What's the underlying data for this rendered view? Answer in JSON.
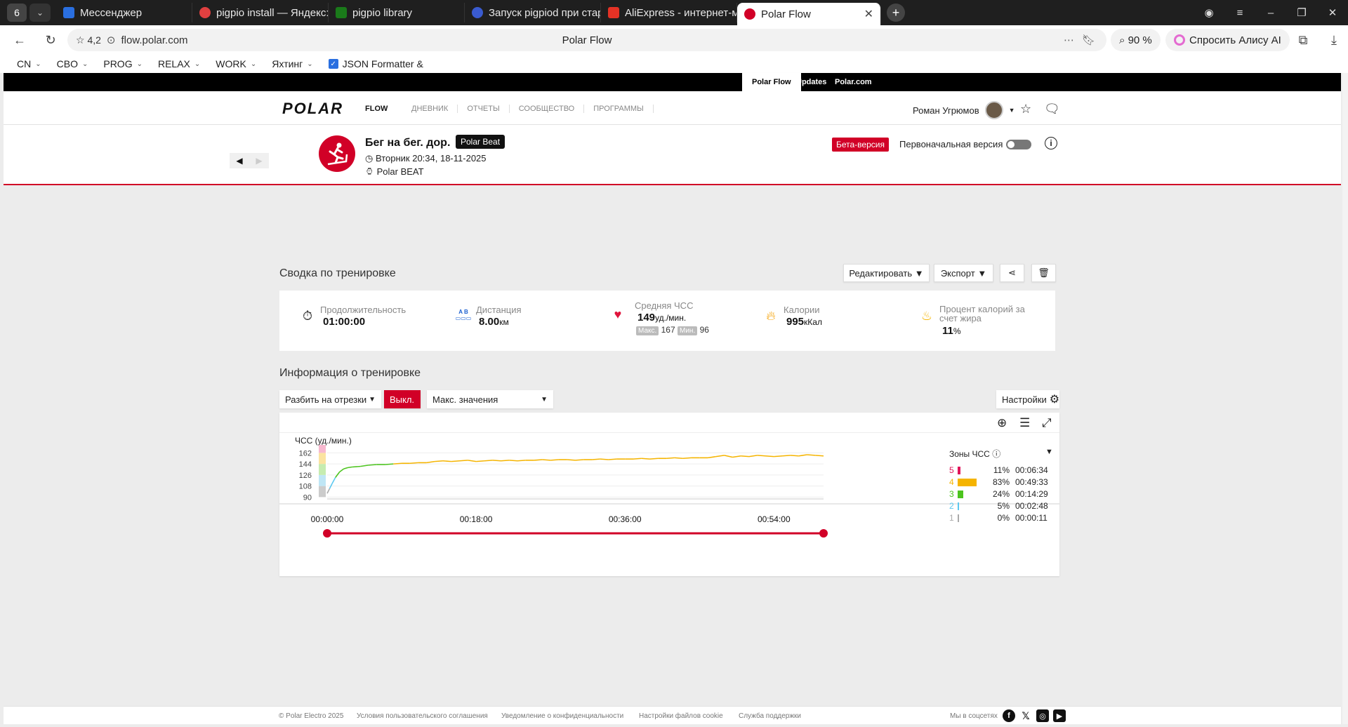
{
  "browser": {
    "tab_count": "6",
    "tabs": [
      {
        "label": "Мессенджер",
        "color": "#2a6fe0"
      },
      {
        "label": "pigpio install — Яндекс: на",
        "color": "#e04040"
      },
      {
        "label": "pigpio library",
        "color": "#1a7a1a"
      },
      {
        "label": "Запуск pigpiod при старт",
        "color": "#3a5bd0"
      },
      {
        "label": "AliExpress - интернет-маг",
        "color": "#e43225"
      },
      {
        "label": "Polar Flow",
        "color": "#d10027"
      }
    ],
    "rating": "4,2",
    "url": "flow.polar.com",
    "page_title": "Polar Flow",
    "zoom": "90 %",
    "alice_label": "Спросить Алису AI",
    "bookmarks": [
      "CN",
      "CBO",
      "PROG",
      "RELAX",
      "WORK",
      "Яхтинг"
    ],
    "bookmark_json": "JSON Formatter &"
  },
  "polar": {
    "top_links": [
      "Polar Flow",
      "Updates",
      "Polar.com"
    ],
    "logo": "POLAR",
    "logo_flow": "FLOW",
    "nav": [
      "ДНЕВНИК",
      "ОТЧЕТЫ",
      "СООБЩЕСТВО",
      "ПРОГРАММЫ"
    ],
    "user_name": "Роман Угрюмов",
    "activity": {
      "title": "Бег на бег. дор.",
      "device_badge": "Polar Beat",
      "datetime": "Вторник 20:34, 18-11-2025",
      "device": "Polar BEAT",
      "beta_label": "Бета-версия",
      "original_label": "Первоначальная версия"
    },
    "summary": {
      "title": "Сводка по тренировке",
      "edit_button": "Редактировать",
      "export_button": "Экспорт",
      "duration_label": "Продолжительность",
      "duration_value": "01:00:00",
      "distance_label": "Дистанция",
      "distance_value": "8.00",
      "distance_unit": "км",
      "distance_icon_text": "A B",
      "hr_label": "Средняя ЧСС",
      "hr_value": "149",
      "hr_unit": "уд./мин.",
      "hr_max_label": "Макс.",
      "hr_max": "167",
      "hr_min_label": "Мин.",
      "hr_min": "96",
      "cal_label": "Калории",
      "cal_value": "995",
      "cal_unit": "кКал",
      "fat_label": "Процент калорий за счет жира",
      "fat_value": "11",
      "fat_unit": "%"
    },
    "info": {
      "title": "Информация о тренировке",
      "split_label": "Разбить на отрезки",
      "off_label": "Выкл.",
      "max_values_label": "Макс. значения",
      "settings_label": "Настройки"
    },
    "zones": {
      "title": "Зоны ЧСС",
      "rows": [
        {
          "zone": "5",
          "pct": "11%",
          "time": "00:06:34",
          "color": "#e0145a",
          "fraction": 0.11
        },
        {
          "zone": "4",
          "pct": "83%",
          "time": "00:49:33",
          "color": "#f5b400",
          "fraction": 0.83
        },
        {
          "zone": "3",
          "pct": "24%",
          "time": "00:14:29",
          "color": "#4cc41e",
          "fraction": 0.24
        },
        {
          "zone": "2",
          "pct": "5%",
          "time": "00:02:48",
          "color": "#5bc8f0",
          "fraction": 0.05
        },
        {
          "zone": "1",
          "pct": "0%",
          "time": "00:00:11",
          "color": "#aaaaaa",
          "fraction": 0.0
        }
      ]
    },
    "footer": {
      "copyright": "© Polar Electro 2025",
      "links": [
        "Условия пользовательского соглашения",
        "Уведомление о конфиденциальности",
        "Настройки файлов cookie",
        "Служба поддержки"
      ],
      "social_label": "Мы в соцсетях"
    }
  },
  "chart_data": {
    "type": "line",
    "ylabel": "ЧСС (уд./мин.)",
    "y_ticks": [
      90,
      108,
      126,
      144,
      162
    ],
    "ylim": [
      87,
      175
    ],
    "x_tick_labels": [
      "00:00:00",
      "00:18:00",
      "00:36:00",
      "00:54:00"
    ],
    "x_ticks_min": [
      0,
      18,
      36,
      54
    ],
    "xlim": [
      0,
      60
    ],
    "zone_bands": [
      {
        "from": 90,
        "to": 108,
        "color": "#cccccc"
      },
      {
        "from": 108,
        "to": 126,
        "color": "#bfe6f5"
      },
      {
        "from": 126,
        "to": 144,
        "color": "#c6ecb0"
      },
      {
        "from": 144,
        "to": 162,
        "color": "#fbe3a0"
      },
      {
        "from": 162,
        "to": 180,
        "color": "#f7b8cf"
      }
    ],
    "series": [
      {
        "x": [
          0,
          0.3,
          0.6,
          1,
          1.5,
          2,
          2.5,
          3,
          4,
          5,
          6,
          7,
          8,
          9,
          10,
          11,
          12,
          13,
          14,
          15,
          16,
          17,
          18,
          19,
          20,
          21,
          22,
          23,
          24,
          25,
          26,
          27,
          28,
          29,
          30,
          31,
          32,
          33,
          34,
          35,
          36,
          37,
          38,
          39,
          40,
          41,
          42,
          43,
          44,
          45,
          46,
          47,
          48,
          49,
          50,
          51,
          52,
          53,
          54,
          55,
          56,
          57,
          58,
          59,
          60
        ],
        "y": [
          96,
          104,
          112,
          122,
          131,
          136,
          138,
          139,
          140,
          142,
          143,
          143,
          144,
          145,
          145,
          146,
          146,
          148,
          149,
          148,
          149,
          150,
          148,
          149,
          150,
          149,
          150,
          149,
          150,
          150,
          151,
          150,
          151,
          151,
          150,
          151,
          151,
          152,
          151,
          152,
          152,
          152,
          153,
          152,
          153,
          153,
          154,
          153,
          154,
          154,
          154,
          156,
          158,
          155,
          157,
          156,
          158,
          157,
          156,
          157,
          158,
          157,
          159,
          158,
          157
        ]
      }
    ]
  }
}
